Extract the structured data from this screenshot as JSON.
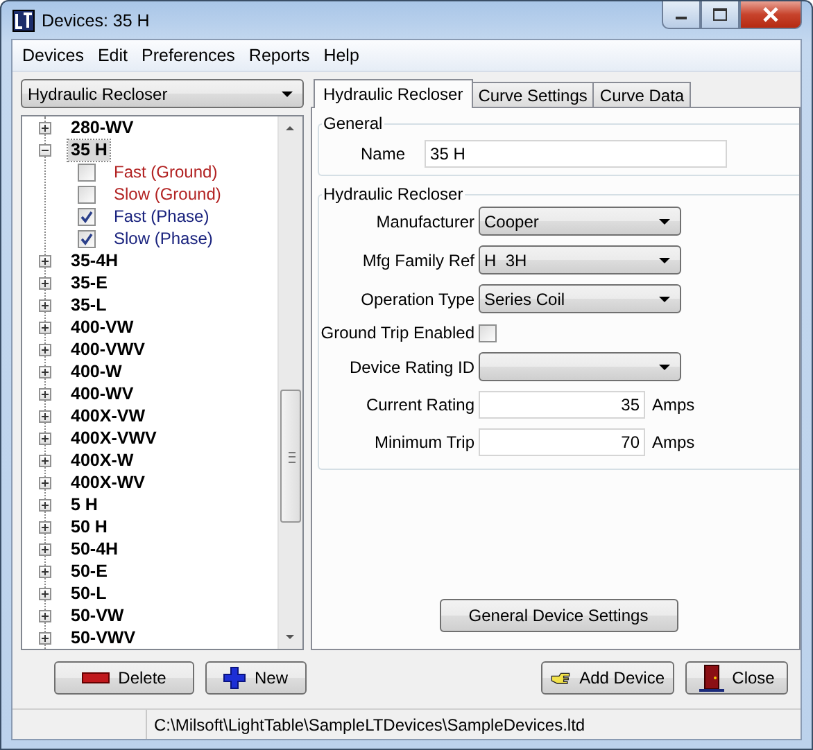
{
  "window": {
    "title": "Devices: 35 H"
  },
  "menu": [
    {
      "label": "Devices"
    },
    {
      "label": "Edit"
    },
    {
      "label": "Preferences"
    },
    {
      "label": "Reports"
    },
    {
      "label": "Help"
    }
  ],
  "device_type": {
    "value": "Hydraulic Recloser"
  },
  "tree": [
    {
      "label": "280-WV",
      "expanded": false,
      "selected": false
    },
    {
      "label": "35 H",
      "expanded": true,
      "selected": true,
      "children": [
        {
          "label": "Fast (Ground)",
          "checked": false,
          "color": "#b22222"
        },
        {
          "label": "Slow (Ground)",
          "checked": false,
          "color": "#b22222"
        },
        {
          "label": "Fast (Phase)",
          "checked": true,
          "color": "#1a237e"
        },
        {
          "label": "Slow (Phase)",
          "checked": true,
          "color": "#1a237e"
        }
      ]
    },
    {
      "label": "35-4H",
      "expanded": false,
      "selected": false
    },
    {
      "label": "35-E",
      "expanded": false,
      "selected": false
    },
    {
      "label": "35-L",
      "expanded": false,
      "selected": false
    },
    {
      "label": "400-VW",
      "expanded": false,
      "selected": false
    },
    {
      "label": "400-VWV",
      "expanded": false,
      "selected": false
    },
    {
      "label": "400-W",
      "expanded": false,
      "selected": false
    },
    {
      "label": "400-WV",
      "expanded": false,
      "selected": false
    },
    {
      "label": "400X-VW",
      "expanded": false,
      "selected": false
    },
    {
      "label": "400X-VWV",
      "expanded": false,
      "selected": false
    },
    {
      "label": "400X-W",
      "expanded": false,
      "selected": false
    },
    {
      "label": "400X-WV",
      "expanded": false,
      "selected": false
    },
    {
      "label": "5 H",
      "expanded": false,
      "selected": false
    },
    {
      "label": "50 H",
      "expanded": false,
      "selected": false
    },
    {
      "label": "50-4H",
      "expanded": false,
      "selected": false
    },
    {
      "label": "50-E",
      "expanded": false,
      "selected": false
    },
    {
      "label": "50-L",
      "expanded": false,
      "selected": false
    },
    {
      "label": "50-VW",
      "expanded": false,
      "selected": false
    },
    {
      "label": "50-VWV",
      "expanded": false,
      "selected": false
    }
  ],
  "tabs": [
    {
      "label": "Hydraulic Recloser",
      "selected": true
    },
    {
      "label": "Curve Settings",
      "selected": false
    },
    {
      "label": "Curve Data",
      "selected": false
    }
  ],
  "general": {
    "title": "General",
    "name_label": "Name",
    "name_value": "35 H"
  },
  "recloser": {
    "title": "Hydraulic Recloser",
    "fields": [
      {
        "kind": "select",
        "label": "Manufacturer",
        "value": "Cooper"
      },
      {
        "kind": "select",
        "label": "Mfg Family Ref",
        "value": "H  3H"
      },
      {
        "kind": "select",
        "label": "Operation Type",
        "value": "Series Coil"
      },
      {
        "kind": "checkbox",
        "label": "Ground Trip Enabled",
        "checked": false
      },
      {
        "kind": "select",
        "label": "Device Rating ID"
      },
      {
        "kind": "number",
        "label": "Current Rating",
        "value": "35",
        "unit": "Amps"
      },
      {
        "kind": "number",
        "label": "Minimum Trip",
        "value": "70",
        "unit": "Amps"
      }
    ]
  },
  "settings_button": {
    "label": "General Device Settings"
  },
  "left_buttons": [
    {
      "kind": "delete",
      "label": "Delete"
    },
    {
      "kind": "new",
      "label": "New"
    }
  ],
  "right_buttons": [
    {
      "kind": "add",
      "label": "Add Device"
    },
    {
      "kind": "close",
      "label": "Close"
    }
  ],
  "status_bar": {
    "path": "C:\\Milsoft\\LightTable\\SampleLTDevices\\SampleDevices.ltd"
  }
}
